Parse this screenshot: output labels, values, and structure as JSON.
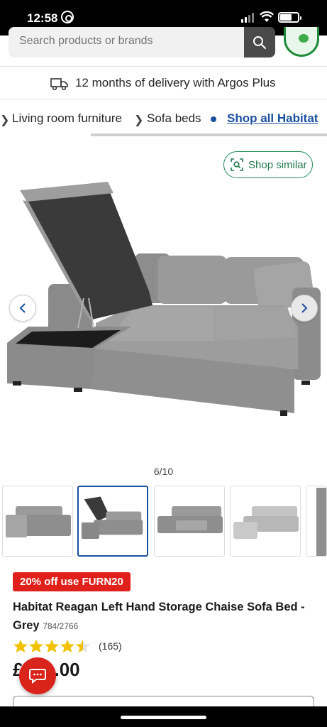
{
  "status_bar": {
    "time": "12:58"
  },
  "search": {
    "placeholder": "Search products or brands"
  },
  "delivery": {
    "text": "12 months of delivery with Argos Plus"
  },
  "breadcrumb": {
    "items": [
      "Living room furniture",
      "Sofa beds"
    ],
    "shop_all": "Shop all Habitat"
  },
  "gallery": {
    "shop_similar": "Shop similar",
    "counter": "6/10",
    "thumbnail_count": 5,
    "active_thumbnail": 2
  },
  "product": {
    "promo": "20% off use FURN20",
    "title": "Habitat Reagan Left Hand Storage Chaise Sofa Bed - Grey",
    "sku": "784/2766",
    "rating": 4.5,
    "review_count": "(165)",
    "price_visible": "£",
    "price_suffix": ".00"
  },
  "colors": {
    "accent_blue": "#1b4fa0",
    "promo_red": "#e0201a",
    "star_yellow": "#f2c200",
    "green": "#1f8a55"
  },
  "icons": [
    "whatsapp-icon",
    "search-icon",
    "truck-icon",
    "chevron-right-icon",
    "visual-search-icon",
    "chevron-left-icon",
    "star-icon",
    "chat-icon"
  ]
}
